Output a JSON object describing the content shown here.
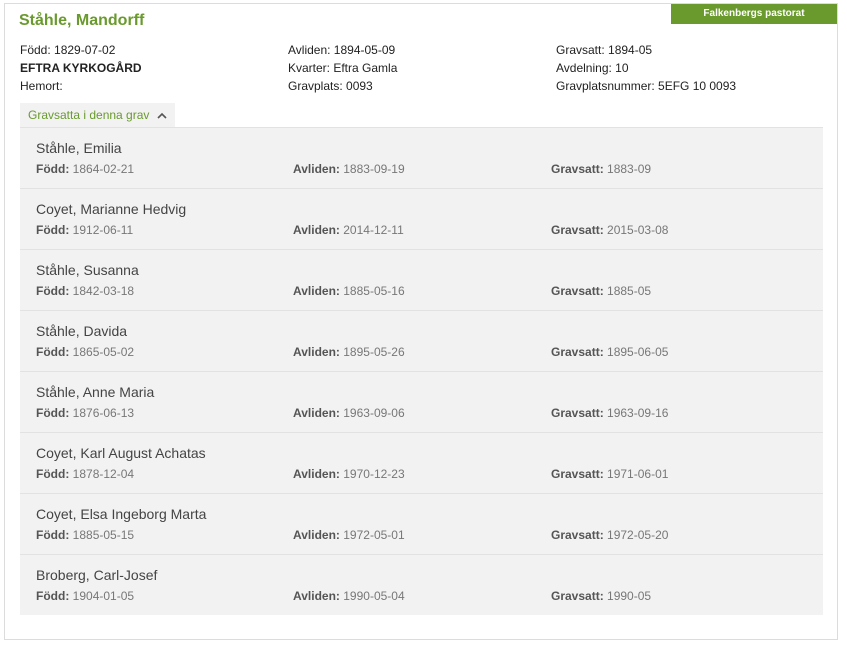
{
  "parish_badge": "Falkenbergs pastorat",
  "grave": {
    "name": "Ståhle, Mandorff",
    "col1": [
      {
        "text": "Född: 1829-07-02",
        "strong": false
      },
      {
        "text": "EFTRA KYRKOGÅRD",
        "strong": true
      },
      {
        "text": "Hemort:",
        "strong": false
      }
    ],
    "col2": [
      {
        "text": "Avliden: 1894-05-09"
      },
      {
        "text": "Kvarter: Eftra Gamla"
      },
      {
        "text": "Gravplats: 0093"
      }
    ],
    "col3": [
      {
        "text": "Gravsatt: 1894-05"
      },
      {
        "text": "Avdelning: 10"
      },
      {
        "text": "Gravplatsnummer: 5EFG 10 0093"
      }
    ]
  },
  "toggle": {
    "label": "Gravsatta i denna grav",
    "icon": "chevron-up-icon"
  },
  "labels": {
    "born": "Född:",
    "died": "Avliden:",
    "buried": "Gravsatt:"
  },
  "buried": [
    {
      "name": "Ståhle, Emilia",
      "born": "1864-02-21",
      "died": "1883-09-19",
      "buried": "1883-09"
    },
    {
      "name": "Coyet, Marianne Hedvig",
      "born": "1912-06-11",
      "died": "2014-12-11",
      "buried": "2015-03-08"
    },
    {
      "name": "Ståhle, Susanna",
      "born": "1842-03-18",
      "died": "1885-05-16",
      "buried": "1885-05"
    },
    {
      "name": "Ståhle, Davida",
      "born": "1865-05-02",
      "died": "1895-05-26",
      "buried": "1895-06-05"
    },
    {
      "name": "Ståhle, Anne Maria",
      "born": "1876-06-13",
      "died": "1963-09-06",
      "buried": "1963-09-16"
    },
    {
      "name": "Coyet, Karl August Achatas",
      "born": "1878-12-04",
      "died": "1970-12-23",
      "buried": "1971-06-01"
    },
    {
      "name": "Coyet, Elsa Ingeborg Marta",
      "born": "1885-05-15",
      "died": "1972-05-01",
      "buried": "1972-05-20"
    },
    {
      "name": "Broberg, Carl-Josef",
      "born": "1904-01-05",
      "died": "1990-05-04",
      "buried": "1990-05"
    }
  ],
  "colors": {
    "accent": "#6a9a2e",
    "row_bg": "#f2f2f2"
  }
}
